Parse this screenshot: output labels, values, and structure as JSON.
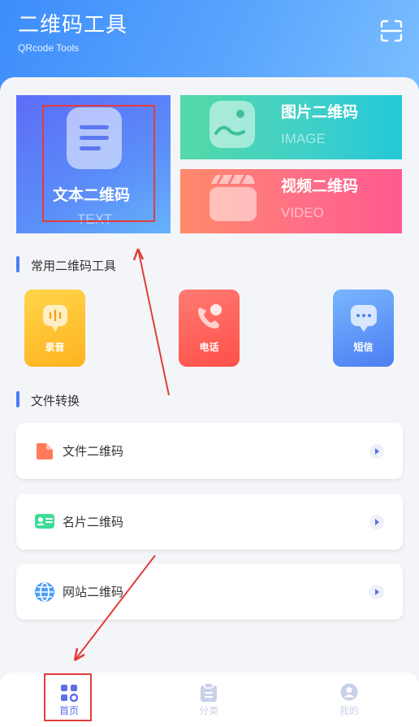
{
  "header": {
    "title": "二维码工具",
    "subtitle": "QRcode Tools",
    "scan_icon": "scan-frame-icon"
  },
  "main_tiles": [
    {
      "title": "文本二维码",
      "subtitle": "TEXT",
      "icon": "document-lines-icon",
      "color": "#5b8ef9"
    },
    {
      "title": "图片二维码",
      "subtitle": "IMAGE",
      "icon": "image-landscape-icon",
      "color": "#3fcfc9"
    },
    {
      "title": "视频二维码",
      "subtitle": "VIDEO",
      "icon": "clapperboard-icon",
      "color": "#ff6f86"
    }
  ],
  "common_tools": {
    "title": "常用二维码工具",
    "items": [
      {
        "label": "录音",
        "icon": "microphone-icon",
        "color": "#ffc233"
      },
      {
        "label": "电话",
        "icon": "phone-icon",
        "color": "#ff5f57"
      },
      {
        "label": "短信",
        "icon": "message-bubble-icon",
        "color": "#5b8ef9"
      }
    ]
  },
  "file_convert": {
    "title": "文件转换",
    "items": [
      {
        "label": "文件二维码",
        "icon": "file-icon",
        "color": "#ff7a59"
      },
      {
        "label": "名片二维码",
        "icon": "id-card-icon",
        "color": "#3ddc97"
      },
      {
        "label": "网站二维码",
        "icon": "globe-icon",
        "color": "#4d9cf8"
      }
    ]
  },
  "tabbar": {
    "items": [
      {
        "label": "首页",
        "icon": "home-grid-icon",
        "active": true
      },
      {
        "label": "分类",
        "icon": "clipboard-icon",
        "active": false
      },
      {
        "label": "我的",
        "icon": "user-icon",
        "active": false
      }
    ],
    "active_color": "#5a6fe8",
    "inactive_color": "#c9d1e8"
  },
  "annotations": {
    "color": "#e23c3c"
  }
}
